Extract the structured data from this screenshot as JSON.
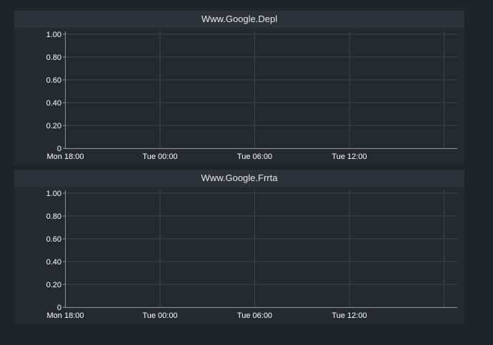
{
  "chart_data": [
    {
      "type": "line",
      "title": "Www.Google.Depl",
      "xlabel": "",
      "ylabel": "",
      "ylim": [
        0,
        1
      ],
      "yticks": [
        "0",
        "0.20",
        "0.40",
        "0.60",
        "0.80",
        "1.00"
      ],
      "xticks": [
        "Mon 18:00",
        "Tue 00:00",
        "Tue 06:00",
        "Tue 12:00"
      ],
      "grid": true,
      "series": []
    },
    {
      "type": "line",
      "title": "Www.Google.Frrta",
      "xlabel": "",
      "ylabel": "",
      "ylim": [
        0,
        1
      ],
      "yticks": [
        "0",
        "0.20",
        "0.40",
        "0.60",
        "0.80",
        "1.00"
      ],
      "xticks": [
        "Mon 18:00",
        "Tue 00:00",
        "Tue 06:00",
        "Tue 12:00"
      ],
      "grid": true,
      "series": []
    }
  ],
  "colors": {
    "background": "#1f232a",
    "panel": "#252a31",
    "header": "#2d323a",
    "grid": "#3c424b"
  }
}
